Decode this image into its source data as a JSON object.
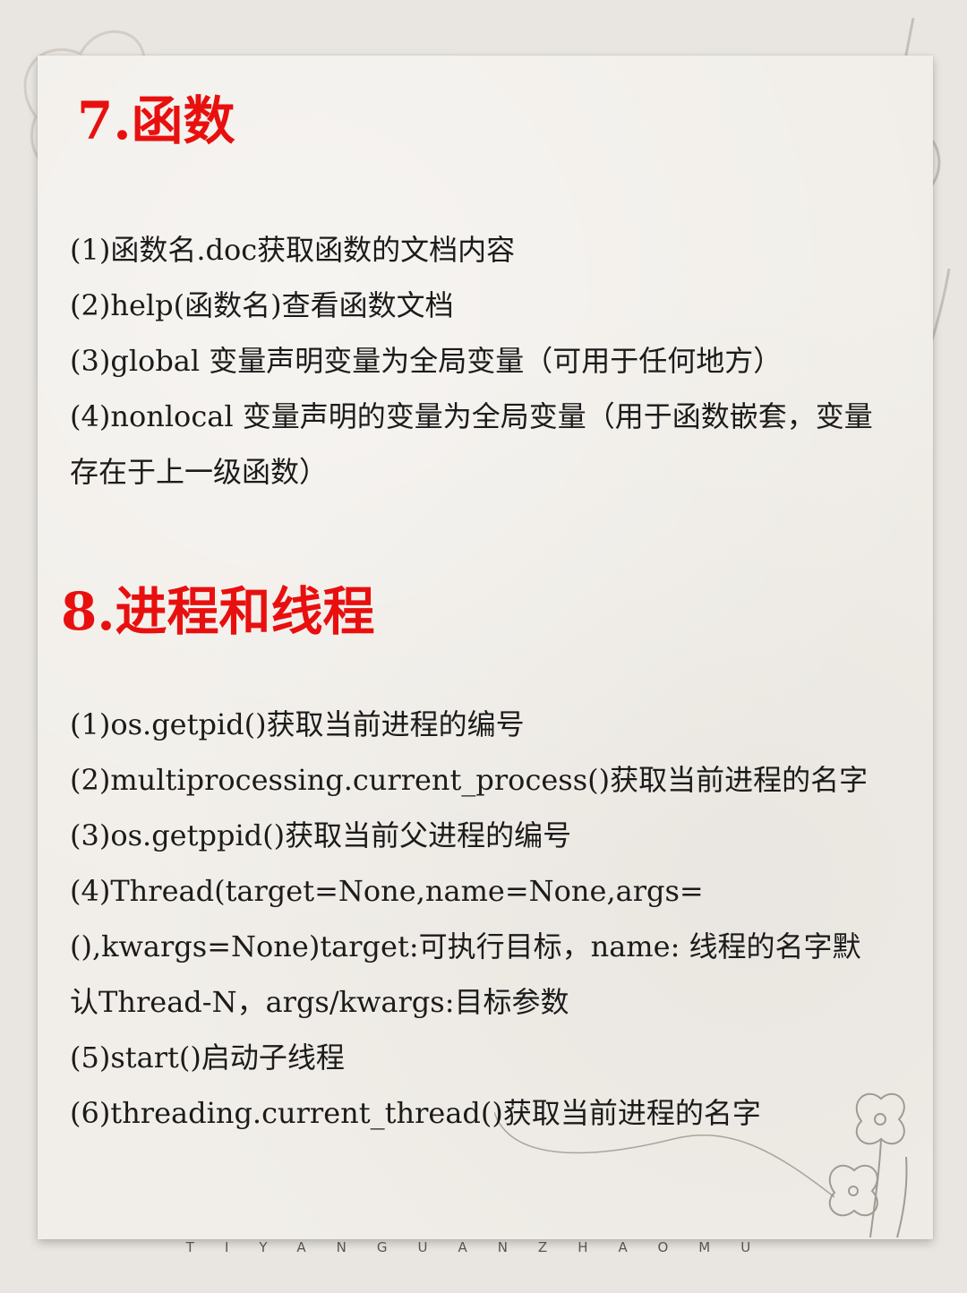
{
  "sections": [
    {
      "heading": "7.函数",
      "items": [
        "(1)函数名.doc获取函数的文档内容",
        "(2)help(函数名)查看函数文档",
        "(3)global 变量声明变量为全局变量（可用于任何地方）",
        "(4)nonlocal 变量声明的变量为全局变量（用于函数嵌套，变量存在于上一级函数）"
      ]
    },
    {
      "heading": "8.进程和线程",
      "items": [
        "(1)os.getpid()获取当前进程的编号",
        "(2)multiprocessing.current_process()获取当前进程的名字",
        "(3)os.getppid()获取当前父进程的编号",
        "(4)Thread(target=None,name=None,args=(),kwargs=None)target:可执行目标，name: 线程的名字默认Thread-N，args/kwargs:目标参数",
        "(5)start()启动子线程",
        "(6)threading.current_thread()获取当前进程的名字"
      ]
    }
  ],
  "footer": "TIYANGUANZHAOMU",
  "colors": {
    "heading": "#e8100f",
    "body_text": "#1b1b1b",
    "paper": "#f1eee9",
    "background": "#e9e6e1"
  }
}
